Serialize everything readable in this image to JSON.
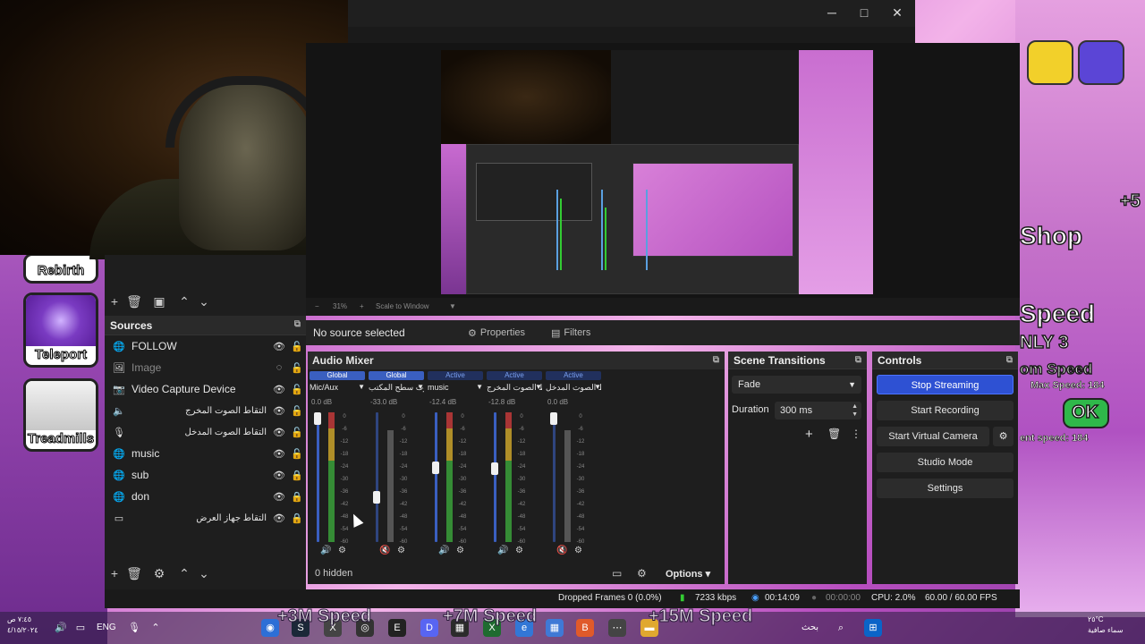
{
  "game": {
    "buttons": [
      {
        "label": "Rebirth",
        "color": "#2a6fd6"
      },
      {
        "label": "Teleport",
        "color": "#8a44c8"
      },
      {
        "label": "Treadmills",
        "color": "#c83030"
      }
    ],
    "right_texts": [
      "Shop",
      "Speed",
      "NLY 3",
      "om Speed",
      "Max Speed: 184",
      "OK",
      "ent speed: 184",
      "+5"
    ],
    "ticker": [
      "+3M Speed",
      "+7M Speed",
      "+15M Speed"
    ]
  },
  "obs": {
    "window_controls": {
      "minimize": "─",
      "maximize": "□",
      "close": "✕"
    },
    "preview_toolbar": {
      "zoom": "31%",
      "scale_mode": "Scale to Window"
    },
    "context_bar": {
      "no_source": "No source selected",
      "properties_label": "Properties",
      "filters_label": "Filters"
    },
    "sources": {
      "title": "Sources",
      "items": [
        {
          "name": "FOLLOW",
          "icon": "globe-icon",
          "rtl": false,
          "hidden": false,
          "locked": false
        },
        {
          "name": "Image",
          "icon": "image-icon",
          "rtl": false,
          "hidden": true,
          "locked": false
        },
        {
          "name": "Video Capture Device",
          "icon": "camera-icon",
          "rtl": false,
          "hidden": false,
          "locked": false
        },
        {
          "name": "التقاط الصوت المخرج",
          "icon": "speaker-icon",
          "rtl": true,
          "hidden": false,
          "locked": false
        },
        {
          "name": "التقاط الصوت المدخل",
          "icon": "mic-icon",
          "rtl": true,
          "hidden": false,
          "locked": false
        },
        {
          "name": "music",
          "icon": "globe-icon",
          "rtl": false,
          "hidden": false,
          "locked": false
        },
        {
          "name": "sub",
          "icon": "globe-icon",
          "rtl": false,
          "hidden": false,
          "locked": true
        },
        {
          "name": "don",
          "icon": "globe-icon",
          "rtl": false,
          "hidden": false,
          "locked": true
        },
        {
          "name": "التقاط جهاز العرض",
          "icon": "monitor-icon",
          "rtl": true,
          "hidden": false,
          "locked": true
        }
      ]
    },
    "mixer": {
      "title": "Audio Mixer",
      "channels": [
        {
          "badge": "Global",
          "badge_type": "global",
          "name": "Mic/Aux",
          "db": "0.0 dB",
          "level": 1.0,
          "muted": false
        },
        {
          "badge": "Global",
          "badge_type": "global",
          "name": "صوت سطح المكتب",
          "db": "-33.0 dB",
          "level": 0.33,
          "muted": true
        },
        {
          "badge": "Active",
          "badge_type": "active",
          "name": "music",
          "db": "-12.4 dB",
          "level": 0.58,
          "muted": false
        },
        {
          "badge": "Active",
          "badge_type": "active",
          "name": "التقاط الصوت المخرج",
          "db": "-12.8 dB",
          "level": 0.57,
          "muted": false
        },
        {
          "badge": "Active",
          "badge_type": "active",
          "name": "التقاط الصوت المدخل",
          "db": "0.0 dB",
          "level": 1.0,
          "muted": true
        }
      ],
      "scale": [
        "0",
        "-6",
        "-12",
        "-18",
        "-24",
        "-30",
        "-36",
        "-42",
        "-48",
        "-54",
        "-60"
      ],
      "hidden_count": "0 hidden",
      "options_label": "Options"
    },
    "transitions": {
      "title": "Scene Transitions",
      "selected": "Fade",
      "duration_label": "Duration",
      "duration_value": "300 ms"
    },
    "controls": {
      "title": "Controls",
      "stop_streaming": "Stop Streaming",
      "start_recording": "Start Recording",
      "start_virtual_camera": "Start Virtual Camera",
      "studio_mode": "Studio Mode",
      "settings": "Settings"
    },
    "status": {
      "dropped_frames": "Dropped Frames 0 (0.0%)",
      "bitrate": "7233 kbps",
      "stream_time": "00:14:09",
      "record_time": "00:00:00",
      "cpu": "CPU: 2.0%",
      "fps": "60.00 / 60.00 FPS"
    }
  },
  "taskbar": {
    "lang": "ENG",
    "time": "٧:٤٥ ص",
    "date": "٤/١٥/٢٠٢٤",
    "weather_temp": "٢٥°C",
    "weather_desc": "سماء صافية",
    "search_label": "بحث"
  },
  "colors": {
    "accent": "#2e51d3",
    "badge_global": "#3a5fc0",
    "badge_active": "#21305d",
    "meter_green": "#3aa03a",
    "meter_yellow": "#c9a22a",
    "meter_red": "#c23a3a",
    "fader_blue": "#3a5fc0"
  }
}
